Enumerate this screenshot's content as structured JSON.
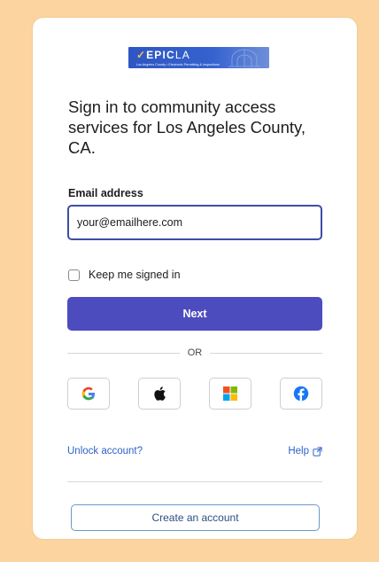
{
  "logo": {
    "brand_bold": "EPIC",
    "brand_light": "LA",
    "tagline": "Los Angeles County • Electronic Permitting & Inspections"
  },
  "heading": "Sign in to community access services for Los Angeles County, CA.",
  "email": {
    "label": "Email address",
    "value": "your@emailhere.com"
  },
  "remember": {
    "label": "Keep me signed in",
    "checked": false
  },
  "next_label": "Next",
  "divider_text": "OR",
  "social": [
    {
      "provider": "Google",
      "icon": "google-icon"
    },
    {
      "provider": "Apple",
      "icon": "apple-icon"
    },
    {
      "provider": "Microsoft",
      "icon": "microsoft-icon"
    },
    {
      "provider": "Facebook",
      "icon": "facebook-icon"
    }
  ],
  "links": {
    "unlock": "Unlock account?",
    "help": "Help"
  },
  "create_account_label": "Create an account",
  "colors": {
    "page_background": "#fcd4a0",
    "primary": "#4c4cbf",
    "link": "#2e63c7",
    "input_focus": "#3f4ba8"
  }
}
